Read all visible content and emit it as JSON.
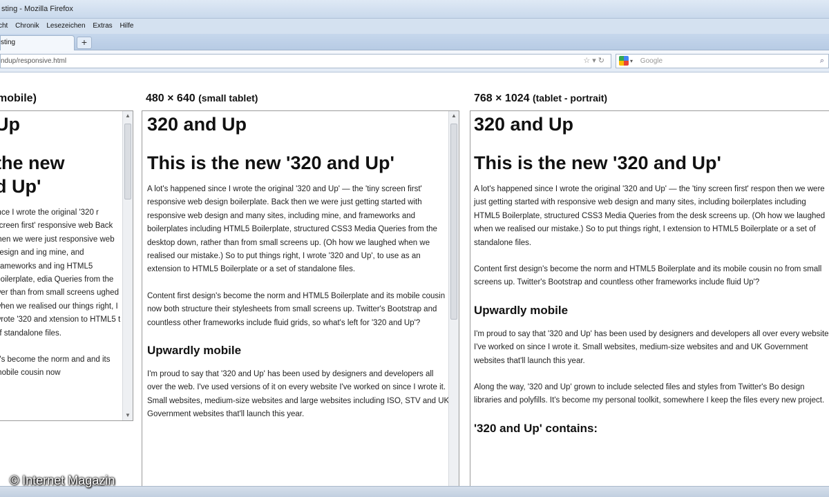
{
  "window": {
    "title": "sting - Mozilla Firefox"
  },
  "menu": {
    "items": [
      "cht",
      "Chronik",
      "Lesezeichen",
      "Extras",
      "Hilfe"
    ]
  },
  "tabs": {
    "active_label": "sting",
    "new_tab_label": "+"
  },
  "navigation": {
    "url": "ndup/responsive.html",
    "search_placeholder": "Google"
  },
  "viewports": [
    {
      "label": "mobile)",
      "sublabel": "",
      "h1": "Up",
      "h2": "the new d Up'",
      "paragraphs": [
        "ince I wrote the original '320 r screen first' responsive web Back then we were just responsive web design and ing mine, and frameworks and ing HTML5 Boilerplate, edia Queries from the wer than from small screens ughed when we realised our things right, I wrote '320 and xtension to HTML5 t of standalone files.",
        "n's become the norm and and its mobile cousin now"
      ]
    },
    {
      "label": "480 × 640",
      "sublabel": "(small tablet)",
      "h1": "320 and Up",
      "h2": "This is the new '320 and Up'",
      "p1": "A lot's happened since I wrote the original '320 and Up' — the 'tiny screen first' responsive web design boilerplate. Back then we were just getting started with responsive web design and many sites, including mine, and frameworks and boilerplates including HTML5 Boilerplate, structured CSS3 Media Queries from the desktop down, rather than from small screens up. (Oh how we laughed when we realised our mistake.) So to put things right, I wrote '320 and Up', to use as an extension to HTML5 Boilerplate or a set of standalone files.",
      "p2": "Content first design's become the norm and HTML5 Boilerplate and its mobile cousin now both structure their stylesheets from small screens up. Twitter's Bootstrap and countless other frameworks include fluid grids, so what's left for '320 and Up'?",
      "h3": "Upwardly mobile",
      "p3": "I'm proud to say that '320 and Up' has been used by designers and developers all over the web. I've used versions of it on every website I've worked on since I wrote it. Small websites, medium-size websites and large websites including ISO, STV and UK Government websites that'll launch this year."
    },
    {
      "label": "768 × 1024",
      "sublabel": "(tablet - portrait)",
      "h1": "320 and Up",
      "h2": "This is the new '320 and Up'",
      "p1": "A lot's happened since I wrote the original '320 and Up' — the 'tiny screen first' respon then we were just getting started with responsive web design and many sites, including boilerplates including HTML5 Boilerplate, structured CSS3 Media Queries from the desk screens up. (Oh how we laughed when we realised our mistake.) So to put things right, I extension to HTML5 Boilerplate or a set of standalone files.",
      "p2": "Content first design's become the norm and HTML5 Boilerplate and its mobile cousin no from small screens up. Twitter's Bootstrap and countless other frameworks include fluid Up'?",
      "h3": "Upwardly mobile",
      "p3": "I'm proud to say that '320 and Up' has been used by designers and developers all over every website I've worked on since I wrote it. Small websites, medium-size websites and and UK Government websites that'll launch this year.",
      "p4": "Along the way, '320 and Up' grown to include selected files and styles from Twitter's Bo design libraries and polyfills. It's become my personal toolkit, somewhere I keep the files every new project.",
      "h4": "'320 and Up' contains:"
    }
  ],
  "watermark": "© Internet Magazin"
}
